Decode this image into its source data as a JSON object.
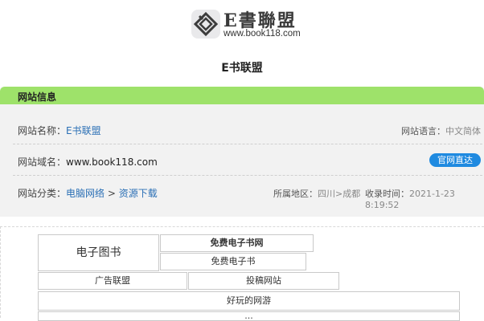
{
  "logo": {
    "title": "E書聯盟",
    "url": "www.book118.com"
  },
  "page_title": "E书联盟",
  "info": {
    "header": "网站信息",
    "name_label": "网站名称：",
    "name_value": "E书联盟",
    "language_label": "网站语言：",
    "language_value": "中文简体",
    "domain_label": "网站域名：",
    "domain_value": "www.book118.com",
    "official_button": "官网直达",
    "category_label": "网站分类：",
    "category_1": "电脑网络",
    "category_sep": ">",
    "category_2": "资源下载",
    "region_label": "所属地区：",
    "region_value": "四川>成都",
    "time_label": "收录时间：",
    "time_value": "2021-1-23 8:19:52"
  },
  "tags": {
    "ebook": "电子图书",
    "free_ebook_site": "免费电子书网",
    "free_ebook": "免费电子书",
    "ad_union": "广告联盟",
    "submit_site": "投稿网站",
    "fun_game": "好玩的网游",
    "partial": "..."
  },
  "colors": {
    "header_green": "#9ee26a",
    "link_blue": "#2a6fb5",
    "button_blue": "#1f8ae0"
  }
}
